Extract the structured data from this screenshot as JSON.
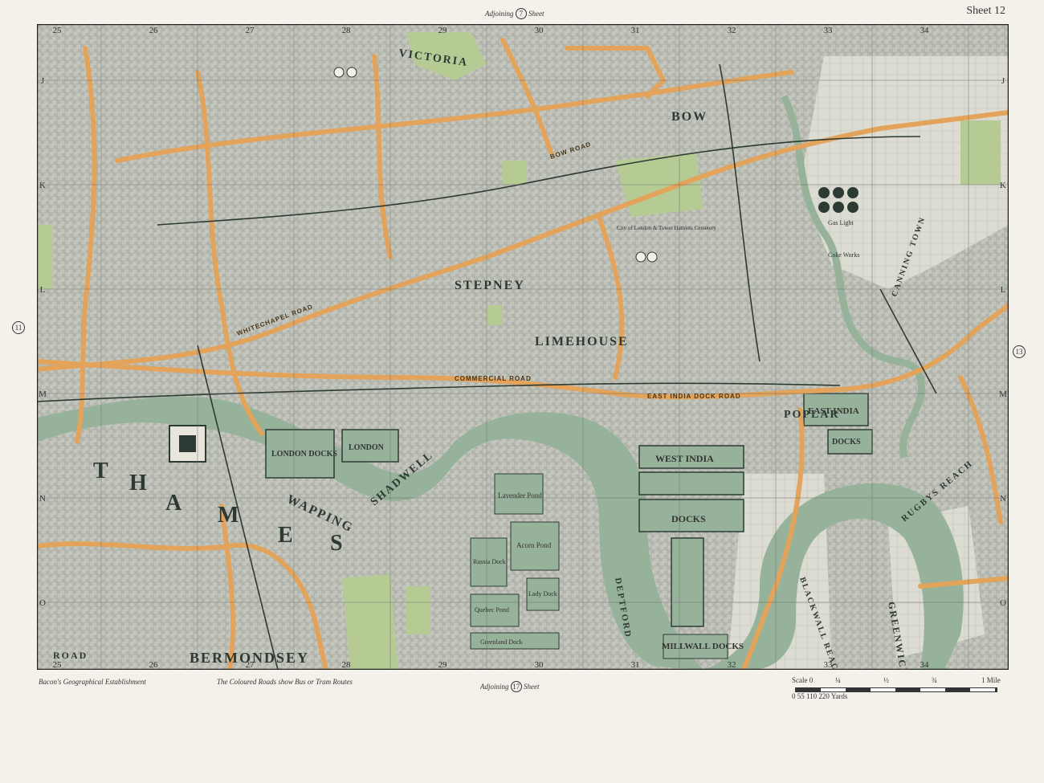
{
  "header": {
    "sheet_title": "Sheet 12",
    "adjoining_top": "Adjoining",
    "adjoining_top_num": "7",
    "adjoining_top_suffix": "Sheet",
    "adjoining_bottom": "Adjoining",
    "adjoining_bottom_num": "17",
    "adjoining_bottom_suffix": "Sheet",
    "adjoining_left_num": "11",
    "adjoining_right_num": "13",
    "adjoining_side_word": "Adjoining Sheet"
  },
  "footer": {
    "publisher": "Bacon's Geographical Establishment",
    "note": "The Coloured Roads show Bus or Tram Routes",
    "scale_label": "Scale 0",
    "scale_yards": "0  55  110  220 Yards",
    "scale_marks": [
      "¼",
      "½",
      "¾",
      "1 Mile"
    ]
  },
  "grid": {
    "columns": [
      "25",
      "26",
      "27",
      "28",
      "29",
      "30",
      "31",
      "32",
      "33",
      "34"
    ],
    "rows": [
      "J",
      "K",
      "L",
      "M",
      "N",
      "O"
    ]
  },
  "labels": {
    "thames": [
      "T",
      "H",
      "A",
      "M",
      "E",
      "S"
    ],
    "london_docks": "LONDON DOCKS",
    "london_docks_short": "LONDON",
    "west_india": "WEST INDIA",
    "docks": "DOCKS",
    "east_india": "EAST INDIA",
    "east_india_docks": "DOCKS",
    "millwall_docks": "MILLWALL DOCKS",
    "lavender_pond": "Lavender Pond",
    "acorn_pond": "Acorn Pond",
    "russia_dock": "Russia Dock",
    "greenland_dock": "Greenland Dock",
    "quebec_pond": "Quebec Pond",
    "lady_dock": "Lady Dock",
    "gas_light": "Gas Light",
    "coke_works": "Coke Works",
    "cemetery": "City of London & Tower Hamlets Cemetery",
    "bow_road": "BOW ROAD",
    "whitechapel_road": "WHITECHAPEL ROAD",
    "commercial_road": "COMMERCIAL ROAD",
    "india_dock_road": "EAST INDIA DOCK ROAD",
    "wapping": "WAPPING",
    "shadwell": "SHADWELL",
    "stepney": "STEPNEY",
    "poplar": "POPLAR",
    "bow": "BOW",
    "victoria": "VICTORIA",
    "limehouse": "LIMEHOUSE",
    "deptford": "DEPTFORD",
    "rugby_reach": "RUGBYS REACH",
    "blackwall_reach": "BLACKWALL REACH",
    "greenwich": "GREENWICH",
    "bermondsey": "BERMONDSEY",
    "old_road": "ROAD",
    "canning_town": "CANNING TOWN"
  },
  "colors": {
    "paper": "#f3f1ea",
    "street_grey": "#b9bcb4",
    "river_green": "#97b29a",
    "park_green": "#b6cb94",
    "route_orange": "#e3a35b"
  }
}
